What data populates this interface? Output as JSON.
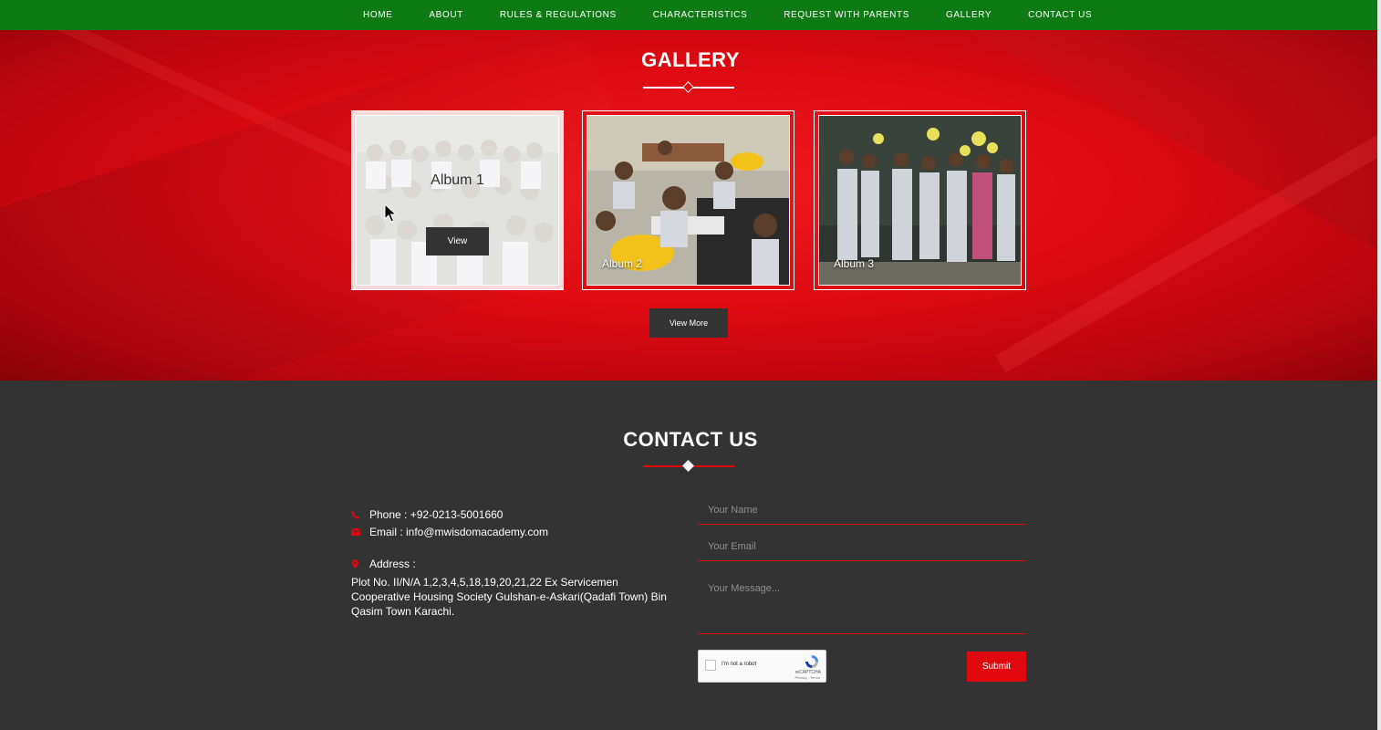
{
  "nav": {
    "items": [
      "HOME",
      "ABOUT",
      "RULES & REGULATIONS",
      "CHARACTERISTICS",
      "REQUEST WITH PARENTS",
      "GALLERY",
      "CONTACT US"
    ]
  },
  "gallery": {
    "title": "GALLERY",
    "albums": [
      {
        "caption": "Album 1",
        "view_label": "View"
      },
      {
        "caption": "Album 2"
      },
      {
        "caption": "Album 3"
      }
    ],
    "view_more_label": "View More"
  },
  "contact": {
    "title": "CONTACT US",
    "phone": "Phone : +92-0213-5001660",
    "email": "Email : info@mwisdomacademy.com",
    "address_label": "Address :",
    "address_text": "Plot No. II/N/A 1,2,3,4,5,18,19,20,21,22 Ex Servicemen Cooperative Housing Society Gulshan-e-Askari(Qadafi Town) Bin Qasim Town Karachi.",
    "form": {
      "name_placeholder": "Your Name",
      "email_placeholder": "Your Email",
      "message_placeholder": "Your Message...",
      "recaptcha_label": "I'm not a robot",
      "recaptcha_brand": "reCAPTCHA",
      "recaptcha_terms": "Privacy - Terms",
      "submit_label": "Submit"
    }
  },
  "colors": {
    "nav_bg": "#0e7a14",
    "accent_red": "#e0070f",
    "dark": "#333333"
  },
  "icons": [
    "phone-icon",
    "envelope-icon",
    "map-marker-icon",
    "cursor-icon"
  ]
}
